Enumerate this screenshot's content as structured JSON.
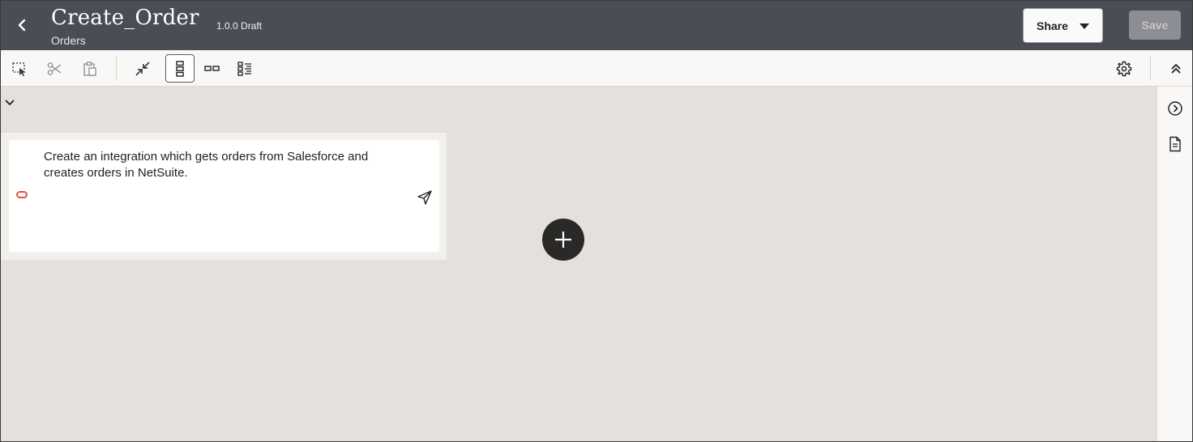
{
  "header": {
    "title": "Create_Order",
    "subtitle": "Orders",
    "version": "1.0.0 Draft",
    "share_label": "Share",
    "save_label": "Save"
  },
  "toolbar": {
    "left_icons": [
      "select-icon",
      "cut-icon",
      "paste-icon",
      "collapse-icon",
      "vertical-layout-icon",
      "horizontal-layout-icon",
      "list-layout-icon"
    ],
    "right_icons": [
      "gear-icon",
      "chevron-double-up-icon"
    ]
  },
  "right_rail": {
    "icons": [
      "chevron-right-circle-icon",
      "document-icon"
    ]
  },
  "canvas": {
    "prompt_text": "Create an integration which gets orders from Salesforce and creates orders in NetSuite."
  },
  "colors": {
    "header_bg": "#4a4d55",
    "canvas_bg": "#e4e1dc",
    "toolbar_bg": "#f9f8f6",
    "accent_red": "#e0523f",
    "add_button": "#2b2928"
  }
}
